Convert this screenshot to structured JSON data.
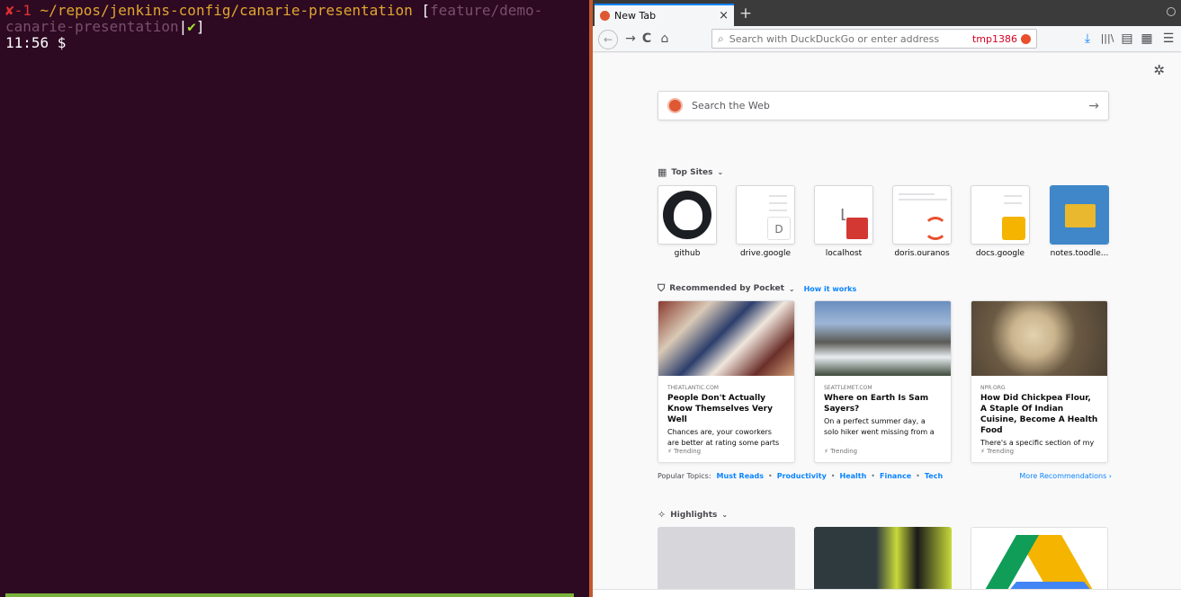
{
  "terminal": {
    "status_mark": "✘",
    "exit_code": "-1",
    "cwd": "~/repos/jenkins-config/canarie-presentation",
    "branch_open": "[",
    "branch_line1": "feature/demo-",
    "branch_line2": "canarie-presentation",
    "branch_sep": "|",
    "check": "✔",
    "branch_close": "]",
    "prompt": "11:56 $"
  },
  "browser": {
    "tab_title": "New Tab",
    "tab_close": "×",
    "new_tab": "+",
    "url_placeholder": "Search with DuckDuckGo or enter address",
    "container_label": "tmp1386",
    "nav": {
      "back": "←",
      "forward": "→",
      "reload": "C",
      "home": "⌂"
    },
    "toolbar": {
      "downloads": "⤓",
      "library": "|||\\",
      "sidebar": "▤",
      "addons": "▦",
      "menu": "☰"
    },
    "colors": {
      "accent": "#0a84ff",
      "ddg": "#de5833"
    }
  },
  "newtab": {
    "settings_icon": "✲",
    "search_placeholder": "Search the Web",
    "search_arrow": "→",
    "top_sites_title": "Top Sites",
    "top_sites": [
      {
        "label": "github"
      },
      {
        "label": "drive.google",
        "letter": "D"
      },
      {
        "label": "localhost",
        "letter": "L"
      },
      {
        "label": "doris.ouranos"
      },
      {
        "label": "docs.google"
      },
      {
        "label": "notes.toodle..."
      }
    ],
    "pocket_title": "Recommended by Pocket",
    "how_it_works": "How it works",
    "stories": [
      {
        "source": "THEATLANTIC.COM",
        "title": "People Don't Actually Know Themselves Very Well",
        "excerpt": "Chances are, your coworkers are better at rating some parts of your",
        "tag": "Trending"
      },
      {
        "source": "SEATTLEMET.COM",
        "title": "Where on Earth Is Sam Sayers?",
        "excerpt": "On a perfect summer day, a solo hiker went missing from a Cascade",
        "tag": "Trending"
      },
      {
        "source": "NPR.ORG",
        "title": "How Did Chickpea Flour, A Staple Of Indian Cuisine, Become A Health Food",
        "excerpt": "There's a specific section of my",
        "tag": "Trending"
      }
    ],
    "popular_label": "Popular Topics:",
    "topics": [
      "Must Reads",
      "Productivity",
      "Health",
      "Finance",
      "Tech"
    ],
    "more_recs": "More Recommendations ›",
    "highlights_title": "Highlights",
    "chevron": "⌄"
  }
}
